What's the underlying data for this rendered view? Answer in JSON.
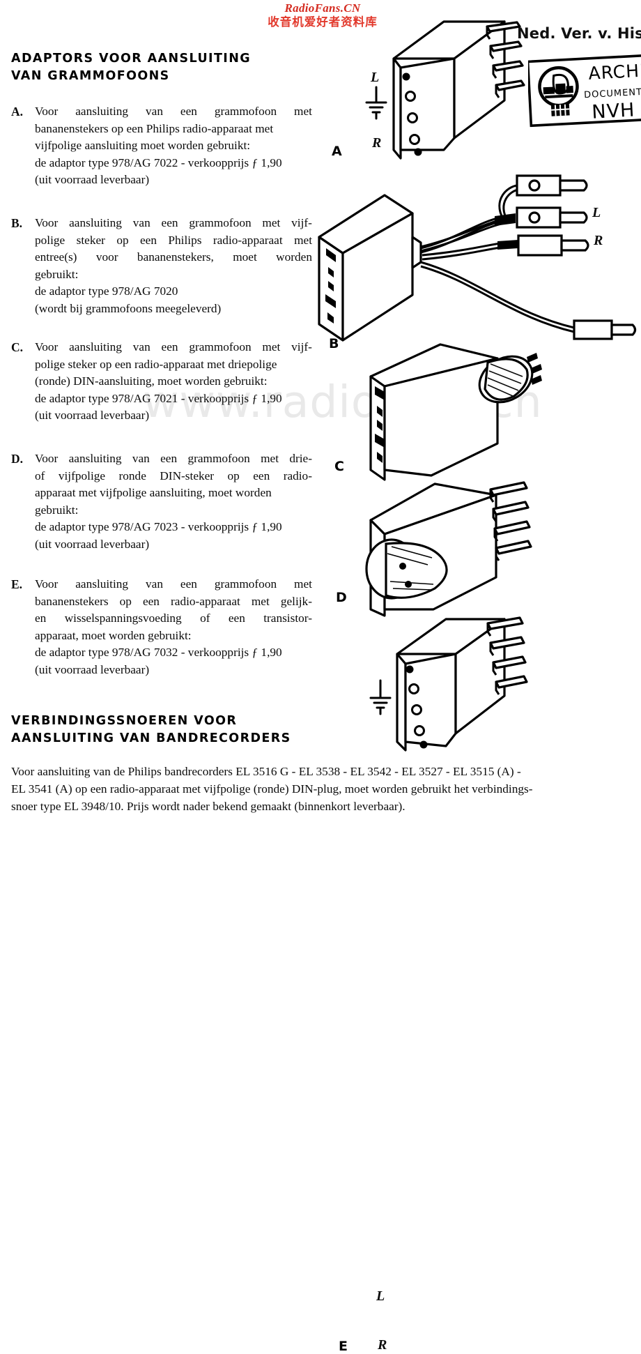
{
  "watermarks": {
    "top_latin": "RadioFans.CN",
    "top_cjk": "收音机爱好者资料库",
    "top_color": "#d42b20",
    "center": "www.radiofans.cn",
    "center_color": "#e9e9e9"
  },
  "headings": {
    "adaptors_line1": "ADAPTORS VOOR AANSLUITING",
    "adaptors_line2": "VAN GRAMMOFOONS",
    "verbindings_line1": "VERBINDINGSSNOEREN VOOR",
    "verbindings_line2": "AANSLUITING VAN BANDRECORDERS"
  },
  "items": [
    {
      "mark": "A.",
      "lines": [
        [
          "Voor",
          "aansluiting",
          "van",
          "een",
          "grammofoon",
          "met"
        ],
        [
          "bananenstekers op een Philips radio-apparaat met"
        ],
        [
          "vijfpolige aansluiting moet worden gebruikt:"
        ],
        [
          "de adaptor type 978/AG 7022 - verkoopprijs ƒ 1,90"
        ],
        [
          "(uit voorraad leverbaar)"
        ]
      ]
    },
    {
      "mark": "B.",
      "lines": [
        [
          "Voor",
          "aansluiting",
          "van",
          "een",
          "grammofoon",
          "met",
          "vijf-"
        ],
        [
          "polige",
          "steker",
          "op",
          "een",
          "Philips",
          "radio-apparaat",
          "met"
        ],
        [
          "entree(s)",
          "voor",
          "bananenstekers,",
          "moet",
          "worden"
        ],
        [
          "gebruikt:"
        ],
        [
          "de adaptor type 978/AG 7020"
        ],
        [
          "(wordt bij grammofoons meegeleverd)"
        ]
      ]
    },
    {
      "mark": "C.",
      "lines": [
        [
          "Voor",
          "aansluiting",
          "van",
          "een",
          "grammofoon",
          "met",
          "vijf-"
        ],
        [
          "polige steker op een radio-apparaat met driepolige"
        ],
        [
          "(ronde) DIN-aansluiting, moet worden gebruikt:"
        ],
        [
          "de adaptor type 978/AG 7021 - verkoopprijs ƒ 1,90"
        ],
        [
          "(uit voorraad leverbaar)"
        ]
      ]
    },
    {
      "mark": "D.",
      "lines": [
        [
          "Voor",
          "aansluiting",
          "van",
          "een",
          "grammofoon",
          "met",
          "drie-"
        ],
        [
          "of",
          "vijfpolige",
          "ronde",
          "DIN-steker",
          "op",
          "een",
          "radio-"
        ],
        [
          "apparaat met vijfpolige aansluiting, moet worden"
        ],
        [
          "gebruikt:"
        ],
        [
          "de adaptor type 978/AG 7023 - verkoopprijs ƒ 1,90"
        ],
        [
          "(uit voorraad leverbaar)"
        ]
      ]
    },
    {
      "mark": "E.",
      "lines": [
        [
          "Voor",
          "aansluiting",
          "van",
          "een",
          "grammofoon",
          "met"
        ],
        [
          "bananenstekers",
          "op",
          "een",
          "radio-apparaat",
          "met",
          "gelijk-"
        ],
        [
          "en",
          "wisselspanningsvoeding",
          "of",
          "een",
          "transistor-"
        ],
        [
          "apparaat, moet worden gebruikt:"
        ],
        [
          "de adaptor type 978/AG 7032 - verkoopprijs ƒ 1,90"
        ],
        [
          "(uit voorraad leverbaar)"
        ]
      ]
    }
  ],
  "bottom_paragraph": [
    "Voor aansluiting van de Philips bandrecorders EL 3516 G - EL 3538 - EL 3542 - EL 3527 - EL 3515 (A) -",
    "EL 3541 (A) op een radio-apparaat met vijfpolige (ronde) DIN-plug, moet worden gebruikt het verbindings-",
    "snoer type EL 3948/10. Prijs wordt nader bekend gemaakt (binnenkort leverbaar)."
  ],
  "figures": {
    "a": {
      "letter": "A",
      "label_l": "L",
      "label_r": "R",
      "ground": "earth-symbol"
    },
    "b": {
      "letter": "B",
      "label_l": "L",
      "label_r": "R"
    },
    "c": {
      "letter": "C"
    },
    "d": {
      "letter": "D"
    },
    "e": {
      "letter": "E",
      "label_l": "L",
      "label_r": "R",
      "ground": "earth-symbol"
    }
  },
  "stamp": {
    "title": "Ned. Ver. v. Hist",
    "line1": "ARCHI",
    "line2": "DOCUMENTATI",
    "line3": "NVH"
  }
}
